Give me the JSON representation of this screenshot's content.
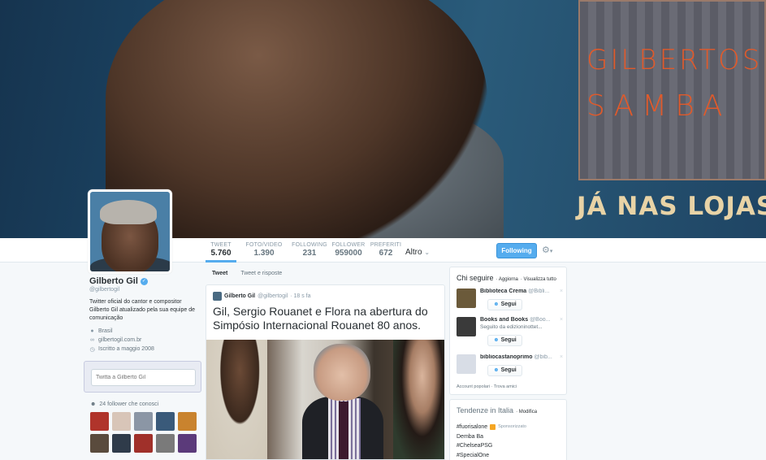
{
  "banner": {
    "album_line1": "GILBERTOS",
    "album_line2": "SAMBA",
    "tagline": "JÁ NAS LOJAS"
  },
  "stats": [
    {
      "label": "TWEET",
      "value": "5.760",
      "active": true
    },
    {
      "label": "FOTO/VIDEO",
      "value": "1.390"
    },
    {
      "label": "FOLLOWING",
      "value": "231"
    },
    {
      "label": "FOLLOWER",
      "value": "959000"
    },
    {
      "label": "PREFERITI",
      "value": "672"
    }
  ],
  "nav": {
    "more_label": "Altro",
    "follow_label": "Following",
    "gear_icon": "gear-icon"
  },
  "profile": {
    "name": "Gilberto Gil",
    "handle": "@gilbertogil",
    "bio": "Twitter oficial do cantor e compositor Gilberto Gil atualizado pela sua equipe de comunicação",
    "location": "Brasil",
    "website": "gilbertogil.com.br",
    "joined": "Iscritto a maggio 2008"
  },
  "tweet_to": {
    "placeholder": "Twitta a Gilberto Gil"
  },
  "followers_you_know": {
    "label": "24 follower che conosci",
    "colors": [
      "#b0342b",
      "#d8c5b8",
      "#8b96a5",
      "#3a5a7a",
      "#c9832e",
      "#5a4b3d",
      "#2f3b4a",
      "#a0302a",
      "#7a7a7a",
      "#5b3a7a"
    ]
  },
  "timeline": {
    "tabs": [
      "Tweet",
      "Tweet e risposte"
    ],
    "tweet": {
      "name": "Gilberto Gil",
      "handle": "@gilbertogil",
      "time": "· 18 s fa",
      "text": "Gil, Sergio Rouanet e Flora na abertura do Simpósio Internacional Rouanet 80 anos."
    }
  },
  "who_to_follow": {
    "title": "Chi seguire",
    "refresh": "· Aggiorna",
    "view_all": "· Visualizza tutto",
    "items": [
      {
        "name": "Biblioteca Crema",
        "handle": "@Bibli...",
        "sub": "",
        "button": "Segui",
        "color": "#6b5a3a"
      },
      {
        "name": "Books and Books",
        "handle": "@Boo...",
        "sub": "Seguito da edizioninottet...",
        "button": "Segui",
        "color": "#3a3a3a"
      },
      {
        "name": "bibliocastanoprimo",
        "handle": "@bib...",
        "sub": "",
        "button": "Segui",
        "color": "#d8dde6"
      }
    ],
    "footer_a": "Account popolari",
    "footer_b": "· Trova amici"
  },
  "trends": {
    "title": "Tendenze in Italia",
    "edit": "· Modifica",
    "items": [
      "#fuorisalone",
      "Demba Ba",
      "#ChelseaPSG",
      "#SpecialOne"
    ],
    "promoted_label": "Sponsorizzato"
  }
}
